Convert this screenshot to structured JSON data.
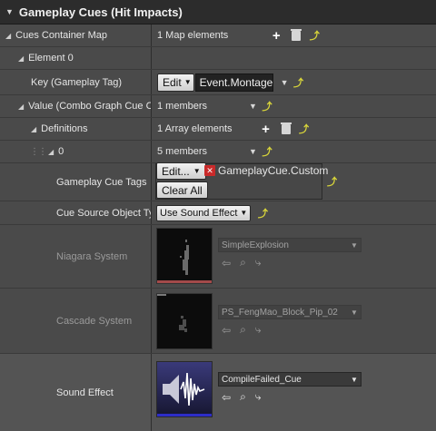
{
  "header": {
    "title": "Gameplay Cues (Hit Impacts)"
  },
  "rows": {
    "cues_container_map": {
      "label": "Cues Container Map",
      "value": "1 Map elements"
    },
    "element0": {
      "label": "Element 0"
    },
    "key": {
      "label": "Key (Gameplay Tag)",
      "edit": "Edit",
      "value": "Event.Montage"
    },
    "value": {
      "label": "Value (Combo Graph Cue Cont",
      "value": "1 members"
    },
    "definitions": {
      "label": "Definitions",
      "value": "1 Array elements"
    },
    "index0": {
      "label": "0",
      "value": "5 members"
    },
    "gameplay_cue_tags": {
      "label": "Gameplay Cue Tags",
      "edit": "Edit...",
      "tag": "GameplayCue.Custom",
      "clear_all": "Clear All"
    },
    "cue_source": {
      "label": "Cue Source Object Type",
      "value": "Use Sound Effect"
    },
    "niagara": {
      "label": "Niagara System",
      "asset": "SimpleExplosion"
    },
    "cascade": {
      "label": "Cascade System",
      "asset": "PS_FengMao_Block_Pip_02"
    },
    "sound": {
      "label": "Sound Effect",
      "asset": "CompileFailed_Cue"
    }
  },
  "icons": {
    "add": "+",
    "reset": "⤴",
    "remove_tag": "✕",
    "back": "⇦",
    "browse": "⌕",
    "reset_small": "⤷"
  },
  "colors": {
    "reset_arrow": "#d9d63a",
    "header_bg": "#2c2c2c",
    "panel_bg": "#4a4a4a",
    "selected_row": "#5a5a5a",
    "tag_remove": "#c92a2a"
  }
}
